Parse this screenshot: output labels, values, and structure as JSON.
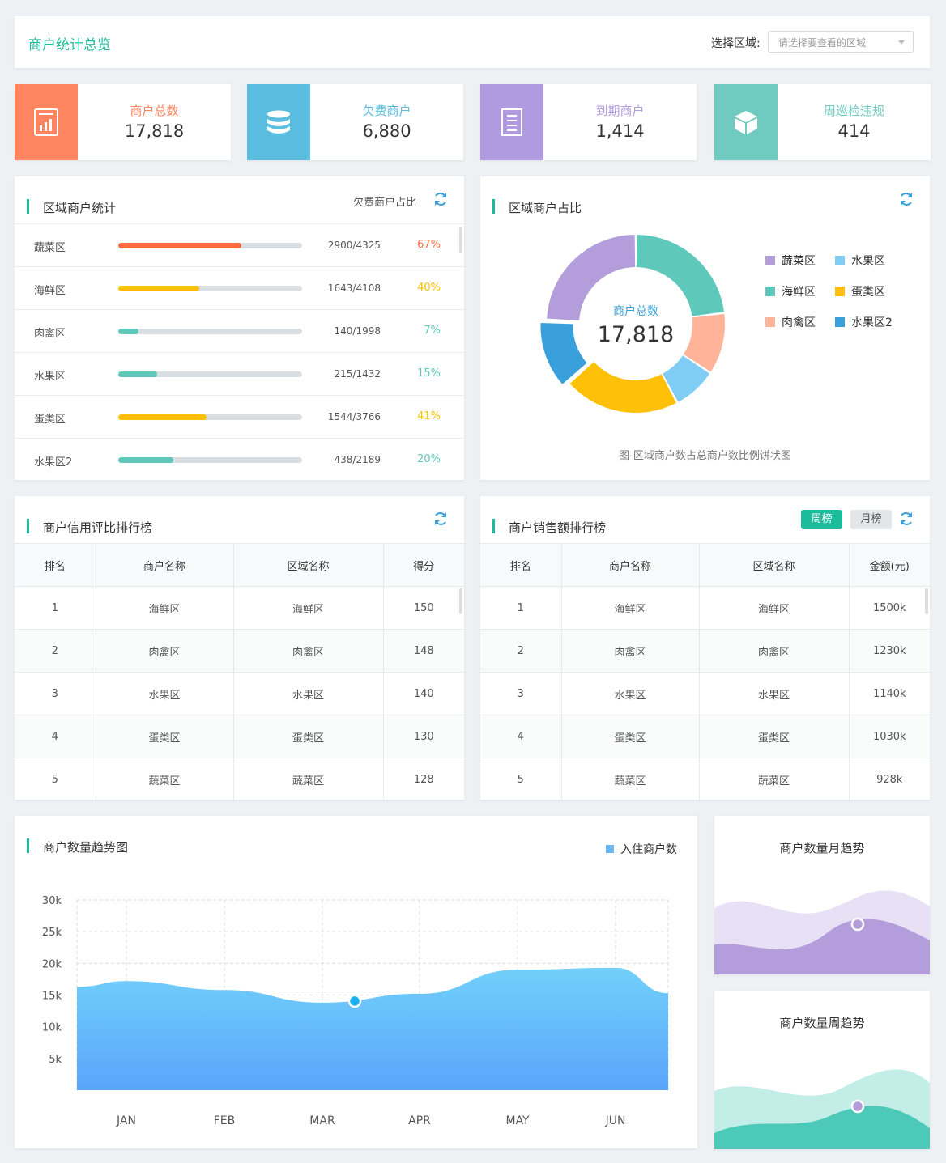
{
  "header": {
    "title": "商户统计总览",
    "region_label": "选择区域:",
    "region_placeholder": "请选择要查看的区域"
  },
  "stats": [
    {
      "label": "商户总数",
      "value": "17,818",
      "color": "#ff8560",
      "icon": "bar-chart-document-icon"
    },
    {
      "label": "欠费商户",
      "value": "6,880",
      "color": "#5bbde0",
      "icon": "database-icon"
    },
    {
      "label": "到期商户",
      "value": "1,414",
      "color": "#b09be0",
      "icon": "document-list-icon"
    },
    {
      "label": "周巡检违规",
      "value": "414",
      "color": "#6fcac0",
      "icon": "cube-icon"
    }
  ],
  "region_stats": {
    "title": "区域商户统计",
    "right_label": "欠费商户占比",
    "rows": [
      {
        "name": "蔬菜区",
        "count": "2900/4325",
        "pct": "67%",
        "ratio": 0.67,
        "color": "#ff6d3f"
      },
      {
        "name": "海鲜区",
        "count": "1643/4108",
        "pct": "40%",
        "ratio": 0.44,
        "color": "#ffc107"
      },
      {
        "name": "肉禽区",
        "count": "140/1998",
        "pct": "7%",
        "ratio": 0.11,
        "color": "#5ec8bb"
      },
      {
        "name": "水果区",
        "count": "215/1432",
        "pct": "15%",
        "ratio": 0.21,
        "color": "#5ec8bb"
      },
      {
        "name": "蛋类区",
        "count": "1544/3766",
        "pct": "41%",
        "ratio": 0.48,
        "color": "#ffc107"
      },
      {
        "name": "水果区2",
        "count": "438/2189",
        "pct": "20%",
        "ratio": 0.3,
        "color": "#5ec8bb"
      }
    ]
  },
  "region_share": {
    "title": "区域商户占比",
    "center_label": "商户总数",
    "center_value": "17,818",
    "caption": "图-区域商户数占总商户数比例饼状图",
    "legend": [
      {
        "name": "蔬菜区",
        "color": "#b39ddb"
      },
      {
        "name": "水果区",
        "color": "#7fcdf5"
      },
      {
        "name": "海鲜区",
        "color": "#5ec8bb"
      },
      {
        "name": "蛋类区",
        "color": "#ffc107"
      },
      {
        "name": "肉禽区",
        "color": "#ffb49a"
      },
      {
        "name": "水果区2",
        "color": "#3aa0dc"
      }
    ]
  },
  "chart_data": [
    {
      "type": "pie",
      "title": "区域商户占比",
      "categories": [
        "海鲜区",
        "肉禽区",
        "水果区",
        "蛋类区",
        "水果区2",
        "蔬菜区"
      ],
      "values": [
        4108,
        1998,
        1432,
        3766,
        2189,
        4325
      ],
      "colors": [
        "#5ec8bb",
        "#ffb49a",
        "#7fcdf5",
        "#ffc107",
        "#3aa0dc",
        "#b39ddb"
      ],
      "highlighted": "水果区2"
    },
    {
      "type": "area",
      "title": "商户数量趋势图",
      "categories": [
        "JAN",
        "FEB",
        "MAR",
        "APR",
        "MAY",
        "JUN"
      ],
      "series": [
        {
          "name": "入住商户数",
          "values": [
            17200,
            15800,
            13800,
            15200,
            19000,
            19300
          ]
        }
      ],
      "ylim": [
        0,
        30000
      ],
      "yticks": [
        "5k",
        "10k",
        "15k",
        "20k",
        "25k",
        "30k"
      ],
      "marker": {
        "category": "MAR",
        "value": 13800
      },
      "grid": true
    }
  ],
  "credit_rank": {
    "title": "商户信用评比排行榜",
    "headers": [
      "排名",
      "商户名称",
      "区域名称",
      "得分"
    ],
    "rows": [
      [
        "1",
        "海鲜区",
        "海鲜区",
        "150"
      ],
      [
        "2",
        "肉禽区",
        "肉禽区",
        "148"
      ],
      [
        "3",
        "水果区",
        "水果区",
        "140"
      ],
      [
        "4",
        "蛋类区",
        "蛋类区",
        "130"
      ],
      [
        "5",
        "蔬菜区",
        "蔬菜区",
        "128"
      ]
    ]
  },
  "sales_rank": {
    "title": "商户销售额排行榜",
    "tab_week": "周榜",
    "tab_month": "月榜",
    "headers": [
      "排名",
      "商户名称",
      "区域名称",
      "金额(元)"
    ],
    "rows": [
      [
        "1",
        "海鲜区",
        "海鲜区",
        "1500k"
      ],
      [
        "2",
        "肉禽区",
        "肉禽区",
        "1230k"
      ],
      [
        "3",
        "水果区",
        "水果区",
        "1140k"
      ],
      [
        "4",
        "蛋类区",
        "蛋类区",
        "1030k"
      ],
      [
        "5",
        "蔬菜区",
        "蔬菜区",
        "928k"
      ]
    ]
  },
  "trend": {
    "title": "商户数量趋势图",
    "legend": "入住商户数"
  },
  "monthly_trend": {
    "title": "商户数量月趋势"
  },
  "weekly_trend": {
    "title": "商户数量周趋势"
  }
}
